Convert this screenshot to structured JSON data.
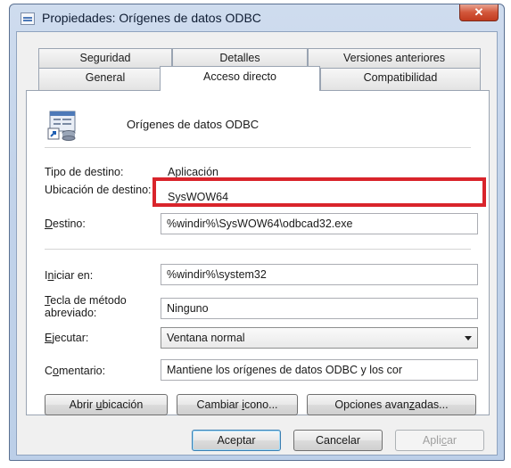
{
  "window": {
    "title": "Propiedades: Orígenes de datos ODBC",
    "close_glyph": "✕"
  },
  "tabs_row1": [
    "Seguridad",
    "Detalles",
    "Versiones anteriores"
  ],
  "tabs_row2": [
    "General",
    "Acceso directo",
    "Compatibilidad"
  ],
  "active_tab": "Acceso directo",
  "shortcut": {
    "name": "Orígenes de datos ODBC",
    "icon": "odbc-shortcut-icon"
  },
  "fields": {
    "target_type_label": "Tipo de destino:",
    "target_type_value": "Aplicación",
    "target_location_label": "Ubicación de destino:",
    "target_location_value": "SysWOW64",
    "target_label": "Destino:",
    "target_value": "%windir%\\SysWOW64\\odbcad32.exe",
    "start_in_label": "Iniciar en:",
    "start_in_value": "%windir%\\system32",
    "shortcut_key_label": "Tecla de método abreviado:",
    "shortcut_key_value": "Ninguno",
    "run_label": "Ejecutar:",
    "run_value": "Ventana normal",
    "comment_label": "Comentario:",
    "comment_value": "Mantiene los orígenes de datos ODBC y los cor"
  },
  "panel_buttons": {
    "open_location": "Abrir ubicación",
    "change_icon": "Cambiar icono...",
    "advanced": "Opciones avanzadas..."
  },
  "dialog_buttons": {
    "ok": "Aceptar",
    "cancel": "Cancelar",
    "apply": "Aplicar"
  },
  "highlight_color": "#d9242b"
}
